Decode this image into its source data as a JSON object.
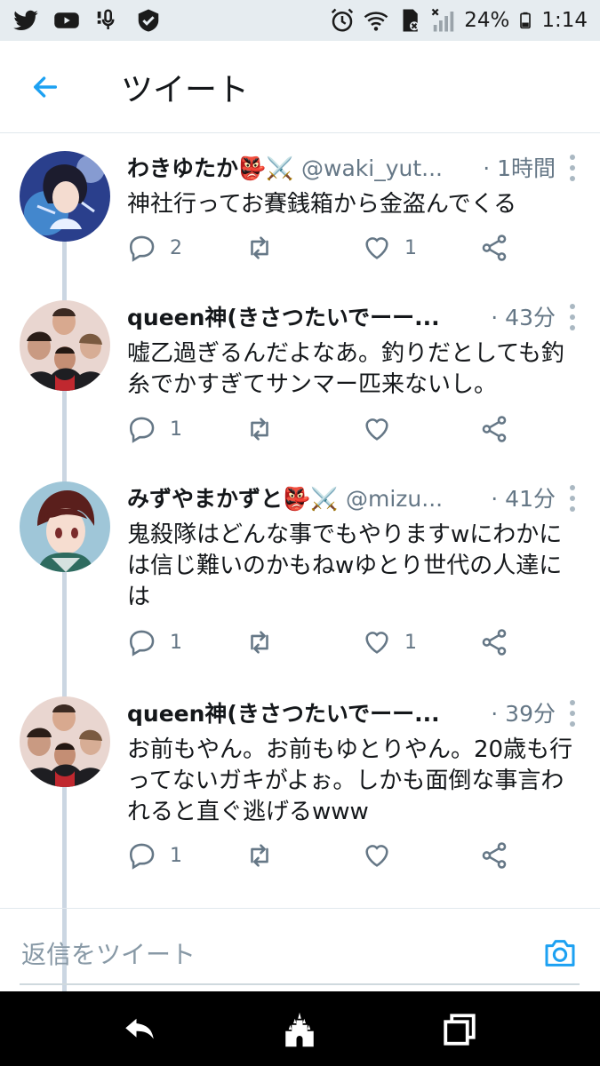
{
  "status_bar": {
    "battery": "24%",
    "time": "1:14",
    "left_icons": [
      "twitter-icon",
      "youtube-icon",
      "voice-icon",
      "shield-icon"
    ],
    "right_icons": [
      "alarm-icon",
      "wifi-icon",
      "sd-card-icon",
      "signal-icon",
      "battery-icon"
    ]
  },
  "header": {
    "title": "ツイート",
    "back_icon": "arrow-left-icon"
  },
  "colors": {
    "accent": "#1da1f2",
    "muted": "#657786",
    "thread_line": "#cbd6e2"
  },
  "tweets": [
    {
      "name": "わきゆたか",
      "emoji": "👺⚔️",
      "handle": "@waki_yut...",
      "time": "· 1時間",
      "text": "神社行ってお賽銭箱から金盗んでくる",
      "replies": "2",
      "likes": "1",
      "avatar": "anime-avatar"
    },
    {
      "name": "queen神(きさつたいでーー...",
      "emoji": "",
      "handle": "",
      "time": "· 43分",
      "text": "嘘乙過ぎるんだよなあ。釣りだとしても釣糸でかすぎてサンマー匹来ないし。",
      "replies": "1",
      "likes": "",
      "avatar": "band-photo-avatar"
    },
    {
      "name": "みずやまかずと",
      "emoji": "👺⚔️",
      "handle": "@mizu...",
      "time": "· 41分",
      "text": "鬼殺隊はどんな事でもやりますwにわかには信じ難いのかもねwゆとり世代の人達には",
      "replies": "1",
      "likes": "1",
      "avatar": "anime-avatar"
    },
    {
      "name": "queen神(きさつたいでーー...",
      "emoji": "",
      "handle": "",
      "time": "· 39分",
      "text": "お前もやん。お前もゆとりやん。20歳も行ってないガキがよぉ。しかも面倒な事言われると直ぐ逃げるwww",
      "replies": "1",
      "likes": "",
      "avatar": "band-photo-avatar"
    }
  ],
  "reply_bar": {
    "placeholder": "返信をツイート",
    "camera_icon": "camera-icon"
  },
  "nav_bar": {
    "icons": [
      "back-icon",
      "home-castle-icon",
      "recents-icon"
    ]
  }
}
